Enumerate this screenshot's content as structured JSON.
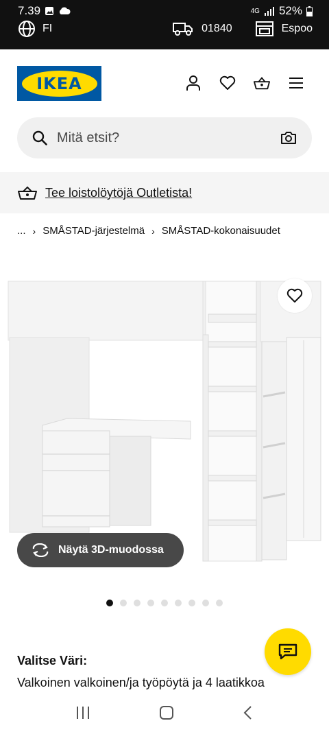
{
  "status_bar": {
    "time": "7.39",
    "battery": "52%",
    "network": "4G",
    "language": "FI",
    "postal_code": "01840",
    "store": "Espoo"
  },
  "header": {
    "logo_text": "IKEA",
    "icons": [
      "user-icon",
      "heart-icon",
      "basket-icon",
      "menu-icon"
    ]
  },
  "search": {
    "placeholder": "Mitä etsit?"
  },
  "banner": {
    "text": "Tee loistolöytöjä Outletista!"
  },
  "breadcrumb": {
    "ellipsis": "...",
    "items": [
      "SMÅSTAD-järjestelmä",
      "SMÅSTAD-kokonaisuudet"
    ]
  },
  "product": {
    "view_3d_label": "Näytä 3D-muodossa",
    "image_count": 9,
    "active_image": 0
  },
  "color": {
    "title": "Valitse Väri:",
    "value": "Valkoinen valkoinen/ja työpöytä ja 4 laatikkoa"
  },
  "colors": {
    "ikea_blue": "#0058a3",
    "ikea_yellow": "#ffdb00"
  }
}
